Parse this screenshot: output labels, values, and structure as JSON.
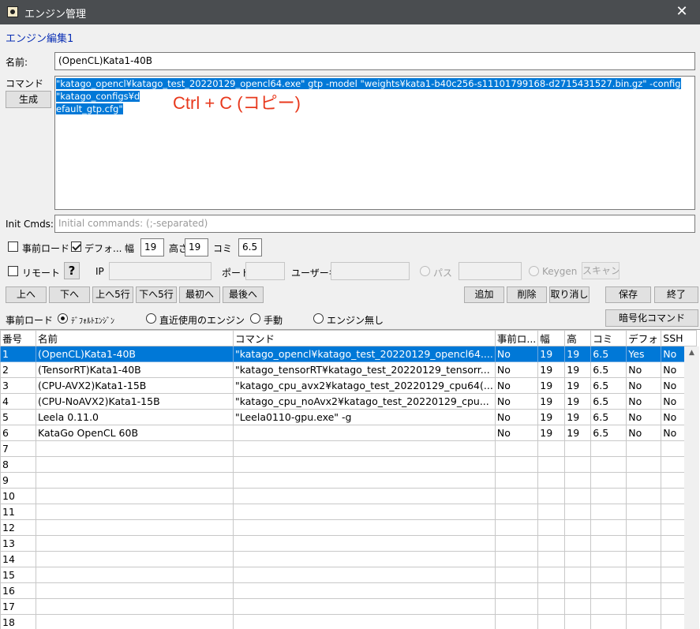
{
  "window": {
    "title": "エンジン管理",
    "close": "✕"
  },
  "edit_title": "エンジン編集1",
  "name_label": "名前:",
  "name_value": "(OpenCL)Kata1-40B",
  "command_label": "コマンド",
  "generate_button": "生成",
  "command_value": "\"katago_opencl¥katago_test_20220129_opencl64.exe\" gtp -model \"weights¥kata1-b40c256-s11101799168-d2715431527.bin.gz\" -config \"katago_configs¥d",
  "command_value_line2": "efault_gtp.cfg\"",
  "annotation": "Ctrl + C (コピー)",
  "init_cmds_label": "Init Cmds:",
  "init_cmds_placeholder": "Initial commands: (;-separated)",
  "options": {
    "preload_label": "事前ロード",
    "preload_checked": false,
    "default_label": "デフォ...",
    "default_checked": true,
    "width_label": "幅",
    "width_value": "19",
    "height_label": "高さ",
    "height_value": "19",
    "komi_label": "コミ",
    "komi_value": "6.5"
  },
  "remote": {
    "remote_label": "リモート",
    "remote_checked": false,
    "help": "?",
    "ip_label": "IP",
    "port_label": "ポート",
    "user_label": "ユーザー名",
    "pass_label": "パス",
    "keygen_label": "Keygen",
    "scan_button": "スキャン"
  },
  "toolbar": {
    "up": "上へ",
    "down": "下へ",
    "up5": "上へ5行",
    "down5": "下へ5行",
    "first": "最初へ",
    "last": "最後へ",
    "add": "追加",
    "delete": "削除",
    "cancel": "取り消し",
    "save": "保存",
    "exit": "終了"
  },
  "preload_mode": {
    "label": "事前ロード",
    "options": [
      "ﾃﾞﾌｫﾙﾄｴﾝｼﾞﾝ",
      "直近使用のエンジン",
      "手動",
      "エンジン無し"
    ],
    "selected": 0,
    "encrypt_button": "暗号化コマンド"
  },
  "table": {
    "headers": [
      "番号",
      "名前",
      "コマンド",
      "事前ロ...",
      "幅",
      "高",
      "コミ",
      "デフォ",
      "SSH"
    ],
    "selected_row": 0,
    "rows": [
      [
        "1",
        "(OpenCL)Kata1-40B",
        "\"katago_opencl¥katago_test_20220129_opencl64....",
        "No",
        "19",
        "19",
        "6.5",
        "Yes",
        "No"
      ],
      [
        "2",
        "(TensorRT)Kata1-40B",
        "\"katago_tensorRT¥katago_test_20220129_tensorr...",
        "No",
        "19",
        "19",
        "6.5",
        "No",
        "No"
      ],
      [
        "3",
        "(CPU-AVX2)Kata1-15B",
        "\"katago_cpu_avx2¥katago_test_20220129_cpu64(...",
        "No",
        "19",
        "19",
        "6.5",
        "No",
        "No"
      ],
      [
        "4",
        "(CPU-NoAVX2)Kata1-15B",
        "\"katago_cpu_noAvx2¥katago_test_20220129_cpu...",
        "No",
        "19",
        "19",
        "6.5",
        "No",
        "No"
      ],
      [
        "5",
        "Leela 0.11.0",
        "\"Leela0110-gpu.exe\" -g",
        "No",
        "19",
        "19",
        "6.5",
        "No",
        "No"
      ],
      [
        "6",
        "KataGo OpenCL 60B",
        "",
        "No",
        "19",
        "19",
        "6.5",
        "No",
        "No"
      ],
      [
        "7",
        "",
        "",
        "",
        "",
        "",
        "",
        "",
        ""
      ],
      [
        "8",
        "",
        "",
        "",
        "",
        "",
        "",
        "",
        ""
      ],
      [
        "9",
        "",
        "",
        "",
        "",
        "",
        "",
        "",
        ""
      ],
      [
        "10",
        "",
        "",
        "",
        "",
        "",
        "",
        "",
        ""
      ],
      [
        "11",
        "",
        "",
        "",
        "",
        "",
        "",
        "",
        ""
      ],
      [
        "12",
        "",
        "",
        "",
        "",
        "",
        "",
        "",
        ""
      ],
      [
        "13",
        "",
        "",
        "",
        "",
        "",
        "",
        "",
        ""
      ],
      [
        "14",
        "",
        "",
        "",
        "",
        "",
        "",
        "",
        ""
      ],
      [
        "15",
        "",
        "",
        "",
        "",
        "",
        "",
        "",
        ""
      ],
      [
        "16",
        "",
        "",
        "",
        "",
        "",
        "",
        "",
        ""
      ],
      [
        "17",
        "",
        "",
        "",
        "",
        "",
        "",
        "",
        ""
      ],
      [
        "18",
        "",
        "",
        "",
        "",
        "",
        "",
        "",
        ""
      ]
    ]
  },
  "colors": {
    "accent": "#0078d7",
    "annotation": "#e8391d",
    "titlebar": "#4a4d50"
  }
}
